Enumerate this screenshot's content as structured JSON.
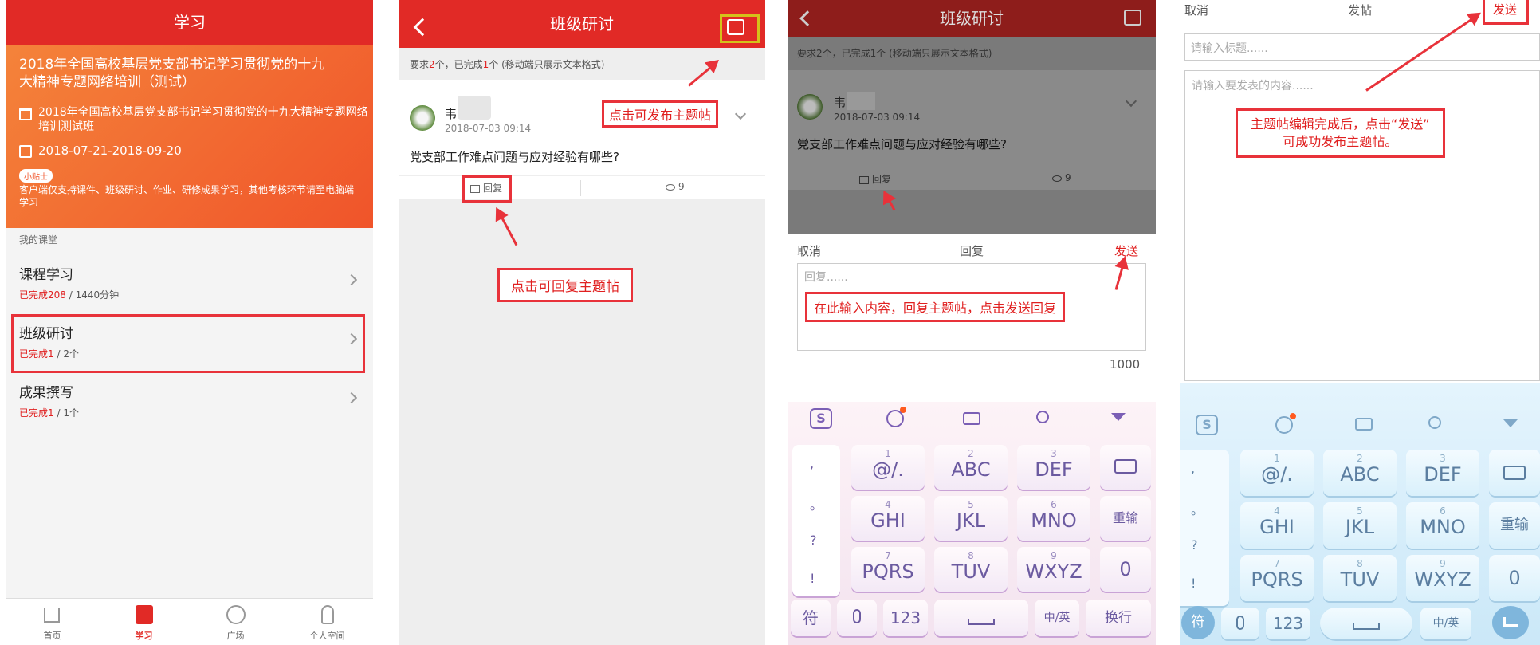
{
  "panel1": {
    "title": "学习",
    "banner_title": "2018年全国高校基层党支部书记学习贯彻党的十九大精神专题网络培训（测试）",
    "class_name": "2018年全国高校基层党支部书记学习贯彻党的十九大精神专题网络培训测试班",
    "date_range": "2018-07-21-2018-09-20",
    "tip_badge": "小贴士",
    "tip_text": "客户端仅支持课件、班级研讨、作业、研修成果学习，其他考核环节请至电脑端学习",
    "section_label": "我的课堂",
    "items": [
      {
        "title": "课程学习",
        "done": "已完成208",
        "rest": " / 1440分钟"
      },
      {
        "title": "班级研讨",
        "done": "已完成1",
        "rest": " / 2个"
      },
      {
        "title": "成果撰写",
        "done": "已完成1",
        "rest": " / 1个"
      }
    ],
    "tabs": [
      "首页",
      "学习",
      "广场",
      "个人空间"
    ]
  },
  "panel2": {
    "title": "班级研讨",
    "req_a": "要求",
    "req_n1": "2",
    "req_b": "个，已完成",
    "req_n2": "1",
    "req_c": "个 (移动端只展示文本格式)",
    "author": "韦",
    "post_time": "2018-07-03 09:14",
    "post_title": "党支部工作难点问题与应对经验有哪些?",
    "reply_label": "回复",
    "view_count": "9",
    "note_publish": "点击可发布主题帖",
    "note_reply": "点击可回复主题帖"
  },
  "panel3": {
    "title": "班级研讨",
    "req": "要求2个，已完成1个 (移动端只展示文本格式)",
    "author": "韦",
    "post_time": "2018-07-03 09:14",
    "post_title": "党支部工作难点问题与应对经验有哪些?",
    "reply_label": "回复",
    "view_count": "9",
    "cancel": "取消",
    "header": "回复",
    "send": "发送",
    "placeholder": "回复......",
    "note": "在此输入内容，回复主题帖，点击发送回复",
    "counter": "1000"
  },
  "panel4": {
    "cancel": "取消",
    "header": "发帖",
    "send": "发送",
    "title_placeholder": "请输入标题......",
    "content_placeholder": "请输入要发表的内容......",
    "note_line1": "主题帖编辑完成后，点击“发送”",
    "note_line2": "可成功发布主题帖。"
  },
  "keyboard": {
    "punct": [
      ",",
      "。",
      "?",
      "!"
    ],
    "rows": [
      [
        {
          "n": "1",
          "l": "@/."
        },
        {
          "n": "2",
          "l": "ABC"
        },
        {
          "n": "3",
          "l": "DEF"
        }
      ],
      [
        {
          "n": "4",
          "l": "GHI"
        },
        {
          "n": "5",
          "l": "JKL"
        },
        {
          "n": "6",
          "l": "MNO"
        }
      ],
      [
        {
          "n": "7",
          "l": "PQRS"
        },
        {
          "n": "8",
          "l": "TUV"
        },
        {
          "n": "9",
          "l": "WXYZ"
        }
      ]
    ],
    "reinput": "重输",
    "zero": "0",
    "symbol": "符",
    "num": "123",
    "lang": "中/英",
    "newline": "换行"
  },
  "colors": {
    "brand_red": "#e02020",
    "annotation_red": "#e8323a",
    "banner_orange": "#f26a2a"
  }
}
